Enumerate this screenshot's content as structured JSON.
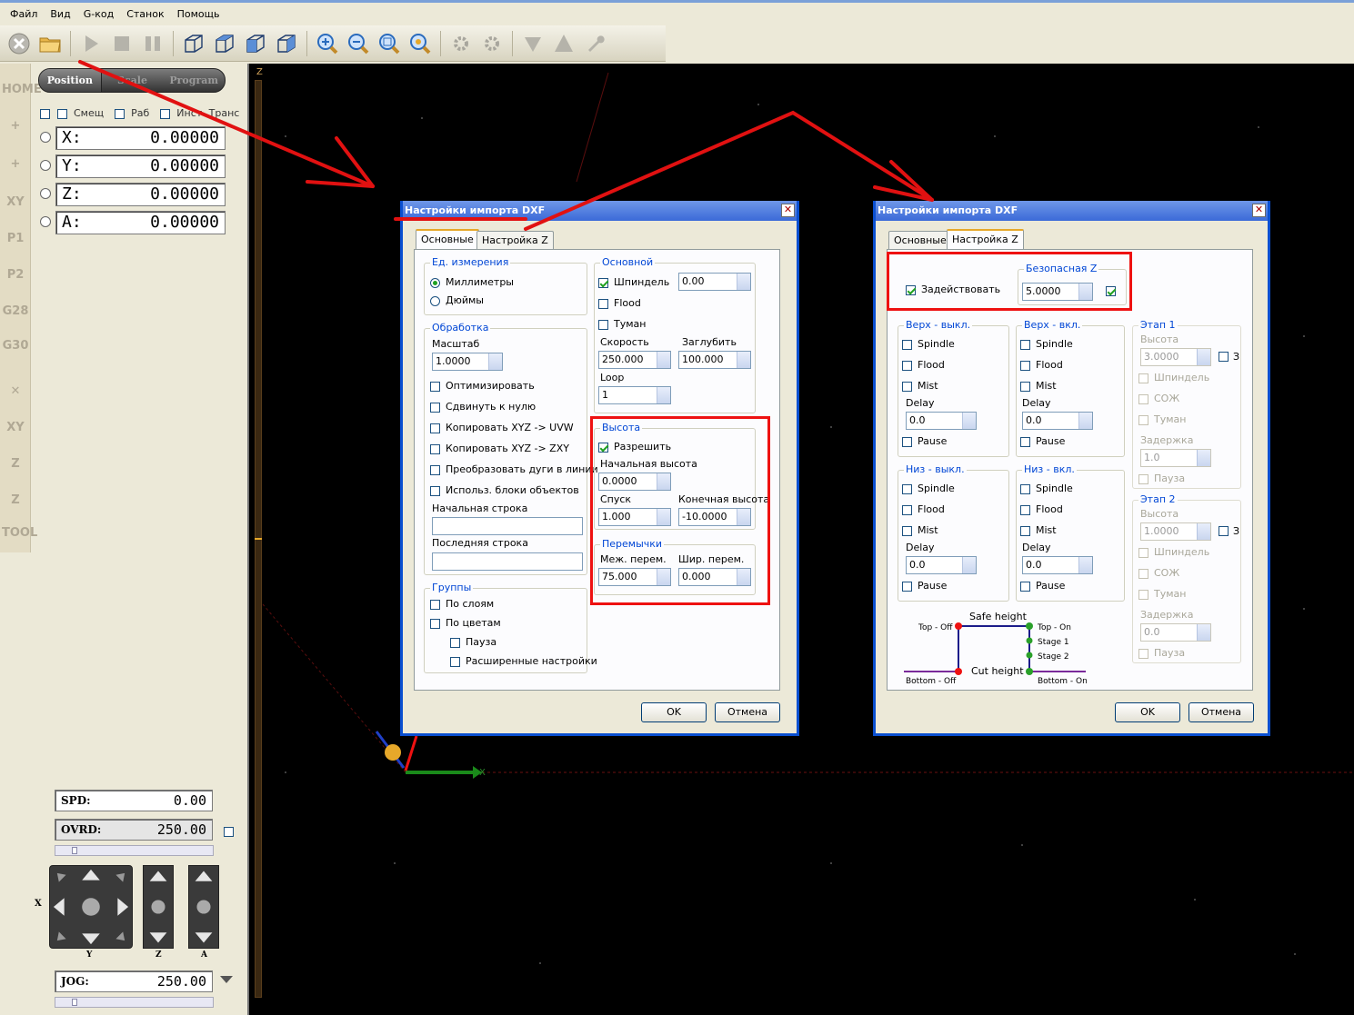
{
  "menu": [
    "Файл",
    "Вид",
    "G-код",
    "Станок",
    "Помощь"
  ],
  "toolbar": {
    "icons": [
      "stop-icon",
      "open-folder-icon",
      "play-icon",
      "stop-square-icon",
      "pause-icon",
      "view-iso-icon",
      "view-top-icon",
      "view-front-icon",
      "view-side-icon",
      "zoom-in-icon",
      "zoom-out-icon",
      "zoom-fit-icon",
      "zoom-window-icon",
      "settings-gear-icon",
      "gear-tool-icon",
      "cnc-arrow-icon",
      "warning-icon",
      "wrench-icon",
      "refresh-icon"
    ]
  },
  "side": {
    "tabs": [
      "Position",
      "Scale",
      "Program"
    ],
    "checks": [
      "Смещ",
      "Раб",
      "Инст",
      "Транс"
    ],
    "axes": [
      {
        "label": "X:",
        "value": "0.00000"
      },
      {
        "label": "Y:",
        "value": "0.00000"
      },
      {
        "label": "Z:",
        "value": "0.00000"
      },
      {
        "label": "A:",
        "value": "0.00000"
      }
    ],
    "icon_labels": [
      "HOME",
      "XY",
      "P1",
      "P2",
      "G28",
      "G30",
      "XY",
      "TOOL"
    ],
    "spd_label": "SPD:",
    "spd_value": "0.00",
    "ovrd_label": "OVRD:",
    "ovrd_value": "250.00",
    "jog_label": "JOG:",
    "jog_value": "250.00",
    "jog_axis_labels": {
      "x": "X",
      "y": "Y",
      "z": "Z",
      "a": "A"
    }
  },
  "canvas": {
    "z_label": "Z",
    "x_axis": "X"
  },
  "dialog1": {
    "title": "Настройки импорта DXF",
    "tabs": [
      "Основные",
      "Настройка Z"
    ],
    "units_group": "Ед. измерения",
    "units": [
      "Миллиметры",
      "Дюймы"
    ],
    "processing_group": "Обработка",
    "scale_label": "Масштаб",
    "scale_value": "1.0000",
    "options": [
      "Оптимизировать",
      "Сдвинуть к нулю",
      "Копировать XYZ -> UVW",
      "Копировать XYZ -> ZXY",
      "Преобразовать дуги в линии",
      "Использ. блоки объектов"
    ],
    "start_line": "Начальная строка",
    "end_line": "Последняя строка",
    "groups_group": "Группы",
    "groups": [
      "По слоям",
      "По цветам",
      "Пауза",
      "Расширенные настройки"
    ],
    "main_group": "Основной",
    "spindle": "Шпиндель",
    "spindle_value": "0.00",
    "flood": "Flood",
    "mist": "Туман",
    "speed_label": "Скорость",
    "speed_value": "250.000",
    "depth_label": "Заглубить",
    "depth_value": "100.000",
    "loop_label": "Loop",
    "loop_value": "1",
    "height_group": "Высота",
    "allow": "Разрешить",
    "start_height": "Начальная высота",
    "start_height_value": "0.0000",
    "descent": "Спуск",
    "descent_value": "1.000",
    "end_height": "Конечная высота",
    "end_height_value": "-10.0000",
    "bridges_group": "Перемычки",
    "bridge_dist": "Меж. перем.",
    "bridge_dist_value": "75.000",
    "bridge_width": "Шир. перем.",
    "bridge_width_value": "0.000",
    "ok": "OK",
    "cancel": "Отмена"
  },
  "dialog2": {
    "title": "Настройки импорта DXF",
    "tabs": [
      "Основные",
      "Настройка Z"
    ],
    "enable": "Задействовать",
    "safe_z_group": "Безопасная Z",
    "safe_z_value": "5.0000",
    "top_off": "Верх - выкл.",
    "top_on": "Верх - вкл.",
    "bottom_off": "Низ - выкл.",
    "bottom_on": "Низ - вкл.",
    "items": [
      "Spindle",
      "Flood",
      "Mist"
    ],
    "delay": "Delay",
    "delay_value": "0.0",
    "pause": "Pause",
    "stage1": "Этап 1",
    "stage2": "Этап 2",
    "height": "Высота",
    "stage1_height": "3.0000",
    "stage2_height": "1.0000",
    "stage_z_char": "З",
    "stage_items": [
      "Шпиндель",
      "СОЖ",
      "Туман"
    ],
    "hold": "Задержка",
    "stage1_hold": "1.0",
    "stage2_hold": "0.0",
    "stage_pause": "Пауза",
    "diagram": {
      "safe_height": "Safe height",
      "cut_height": "Cut height",
      "top_off": "Top - Off",
      "top_on": "Top - On",
      "stage1": "Stage 1",
      "stage2": "Stage 2",
      "bottom_off": "Bottom - Off",
      "bottom_on": "Bottom - On"
    },
    "ok": "OK",
    "cancel": "Отмена"
  },
  "colors": {
    "annotation": "#e11111",
    "title_bar": "#3b6ad8",
    "canvas": "#000000"
  }
}
